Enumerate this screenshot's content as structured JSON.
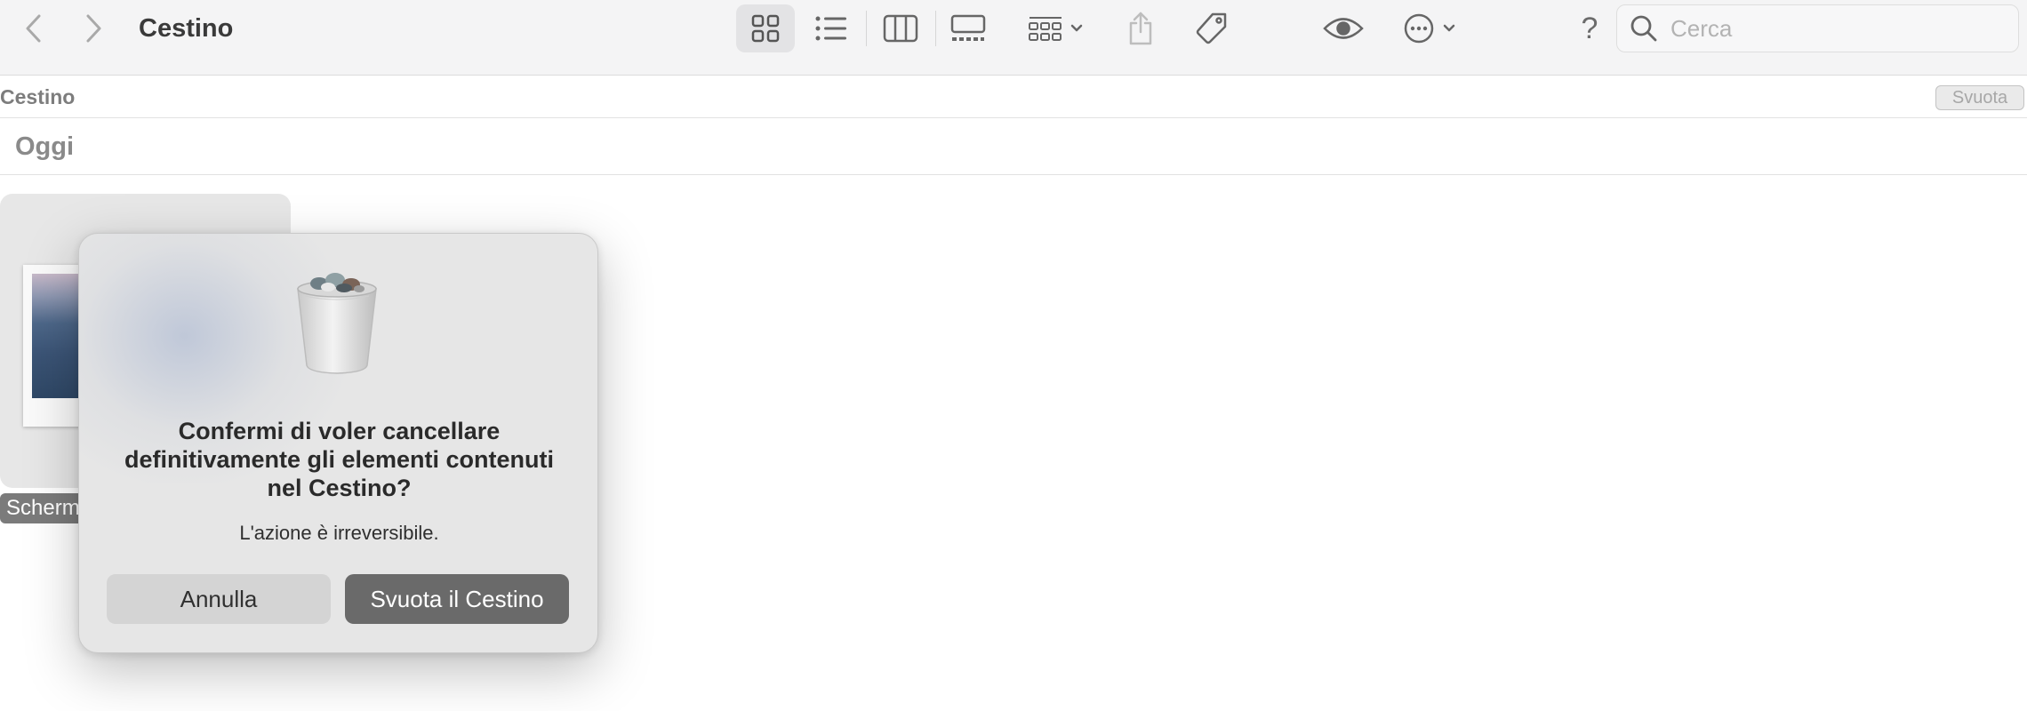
{
  "window": {
    "title": "Cestino",
    "search_placeholder": "Cerca",
    "help_glyph": "?"
  },
  "toolbar": {
    "icons": [
      "back-icon",
      "forward-icon",
      "icon-view-icon",
      "list-view-icon",
      "column-view-icon",
      "gallery-view-icon",
      "group-icon",
      "share-icon",
      "tag-icon",
      "quicklook-icon",
      "more-actions-icon",
      "help-icon",
      "search-icon"
    ]
  },
  "pathbar": {
    "title": "Cestino",
    "empty_button": "Svuota"
  },
  "section": {
    "title": "Oggi"
  },
  "file": {
    "label": "Scherm"
  },
  "dialog": {
    "title": "Confermi di voler cancellare definitivamente gli elementi contenuti nel Cestino?",
    "message": "L'azione è irreversibile.",
    "cancel": "Annulla",
    "confirm": "Svuota il Cestino",
    "icon": "trash-full-icon"
  },
  "colors": {
    "toolbar_bg": "#f4f4f5",
    "selected_view_bg": "#e3e3e5",
    "dialog_bg": "#e6e6e6",
    "confirm_button": "#6a6a6a",
    "cancel_button": "#d4d4d4"
  }
}
